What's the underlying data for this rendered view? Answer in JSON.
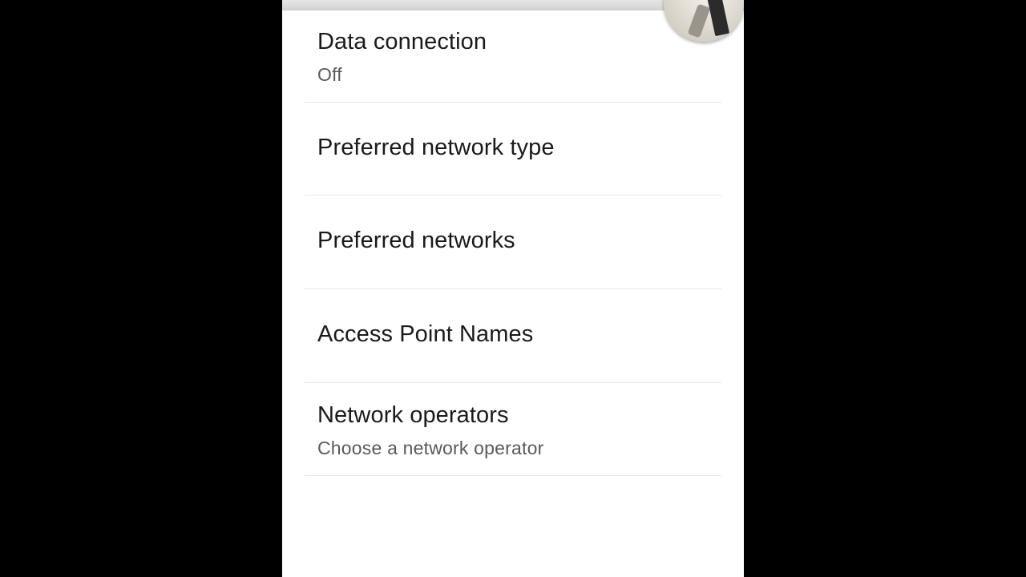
{
  "settings": {
    "items": [
      {
        "title": "Data connection",
        "summary": "Off"
      },
      {
        "title": "Preferred network type",
        "summary": ""
      },
      {
        "title": "Preferred networks",
        "summary": ""
      },
      {
        "title": "Access Point Names",
        "summary": ""
      },
      {
        "title": "Network operators",
        "summary": "Choose a network operator"
      }
    ]
  },
  "colors": {
    "letterbox": "#000000",
    "screen_background": "#ffffff",
    "title_text": "#1a1a1a",
    "summary_text": "#5a5a5a",
    "divider": "#e4e4e4"
  },
  "icons": {
    "avatar": "contact-photo-avatar"
  }
}
